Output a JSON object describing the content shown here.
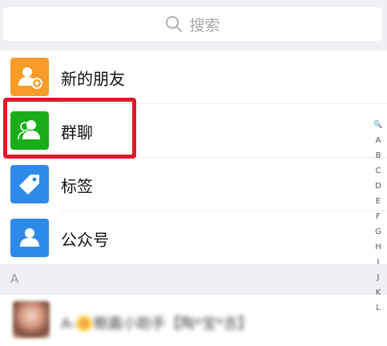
{
  "search": {
    "placeholder": "搜索",
    "icon": "search-icon"
  },
  "function_rows": [
    {
      "label": "新的朋友",
      "icon": "add-friend-icon",
      "color": "#f79c29"
    },
    {
      "label": "群聊",
      "icon": "group-chat-icon",
      "color": "#1aad19"
    },
    {
      "label": "标签",
      "icon": "tag-icon",
      "color": "#2d8ae8"
    },
    {
      "label": "公众号",
      "icon": "official-account-icon",
      "color": "#2d8ae8"
    }
  ],
  "section_header": "A",
  "contacts": [
    {
      "name": "A-🌼鲍嘉小助手【陶*宝*吉】"
    }
  ],
  "index_bar": [
    "🔍",
    "A",
    "B",
    "C",
    "D",
    "E",
    "F",
    "G",
    "H",
    "I",
    "J",
    "K",
    "L"
  ],
  "highlight_color": "#e0192a"
}
